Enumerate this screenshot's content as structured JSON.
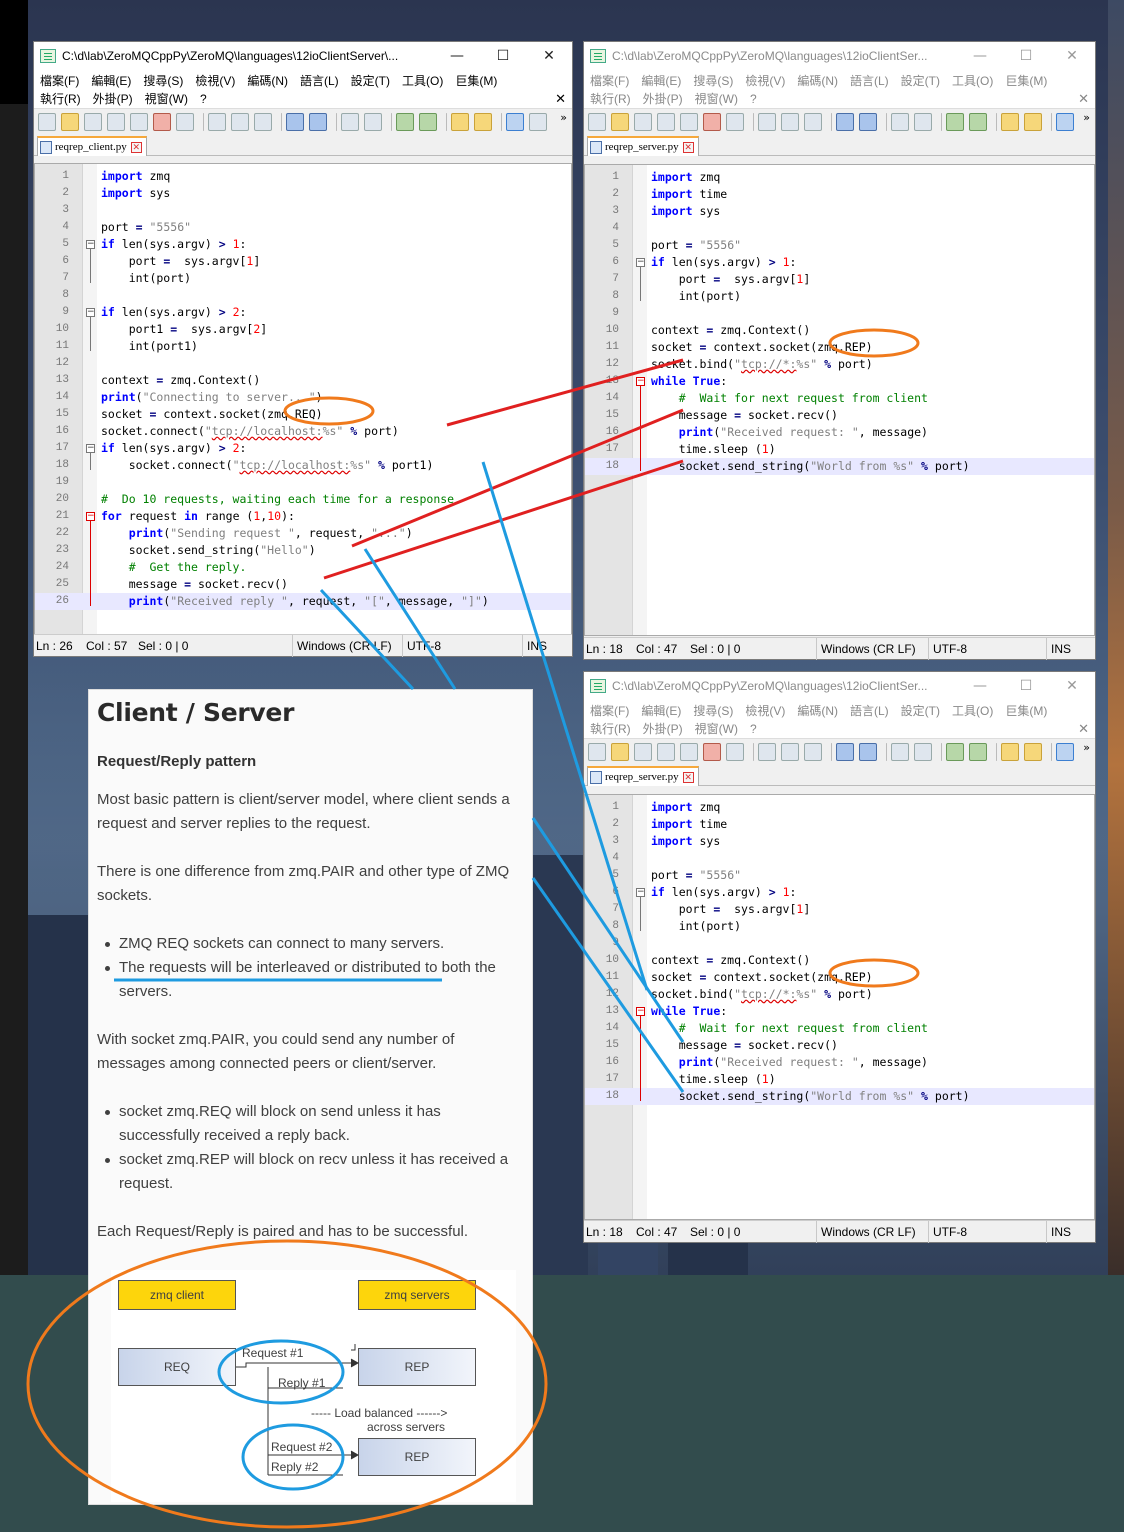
{
  "client_window": {
    "title": "C:\\d\\lab\\ZeroMQCppPy\\ZeroMQ\\languages\\12ioClientServer\\...",
    "menu_row1": [
      "檔案(F)",
      "編輯(E)",
      "搜尋(S)",
      "檢視(V)",
      "編碼(N)",
      "語言(L)",
      "設定(T)",
      "工具(O)",
      "巨集(M)"
    ],
    "menu_row2": [
      "執行(R)",
      "外掛(P)",
      "視窗(W)",
      "?"
    ],
    "tab_label": "reqrep_client.py",
    "status": {
      "ln": "Ln : 26",
      "col": "Col : 57",
      "sel": "Sel : 0 | 0",
      "eol": "Windows (CR LF)",
      "enc": "UTF-8",
      "mode": "INS"
    },
    "lines": [
      "import zmq",
      "import sys",
      "",
      "port = \"5556\"",
      "if len(sys.argv) > 1:",
      "    port =  sys.argv[1]",
      "    int(port)",
      "",
      "if len(sys.argv) > 2:",
      "    port1 =  sys.argv[2]",
      "    int(port1)",
      "",
      "context = zmq.Context()",
      "print(\"Connecting to server...\")",
      "socket = context.socket(zmq.REQ)",
      "socket.connect(\"tcp://localhost:%s\" % port)",
      "if len(sys.argv) > 2:",
      "    socket.connect(\"tcp://localhost:%s\" % port1)",
      "",
      "#  Do 10 requests, waiting each time for a response",
      "for request in range (1,10):",
      "    print(\"Sending request \", request, \"...\")",
      "    socket.send_string(\"Hello\")",
      "    #  Get the reply.",
      "    message = socket.recv()",
      "    print(\"Received reply \", request, \"[\", message, \"]\")"
    ]
  },
  "server_window_1": {
    "title": "C:\\d\\lab\\ZeroMQCppPy\\ZeroMQ\\languages\\12ioClientSer...",
    "menu_row1": [
      "檔案(F)",
      "編輯(E)",
      "搜尋(S)",
      "檢視(V)",
      "編碼(N)",
      "語言(L)",
      "設定(T)",
      "工具(O)",
      "巨集(M)"
    ],
    "menu_row2": [
      "執行(R)",
      "外掛(P)",
      "視窗(W)",
      "?"
    ],
    "tab_label": "reqrep_server.py",
    "status": {
      "ln": "Ln : 18",
      "col": "Col : 47",
      "sel": "Sel : 0 | 0",
      "eol": "Windows (CR LF)",
      "enc": "UTF-8",
      "mode": "INS"
    },
    "lines": [
      "import zmq",
      "import time",
      "import sys",
      "",
      "port = \"5556\"",
      "if len(sys.argv) > 1:",
      "    port =  sys.argv[1]",
      "    int(port)",
      "",
      "context = zmq.Context()",
      "socket = context.socket(zmq.REP)",
      "socket.bind(\"tcp://*:%s\" % port)",
      "while True:",
      "    #  Wait for next request from client",
      "    message = socket.recv()",
      "    print(\"Received request: \", message)",
      "    time.sleep (1)",
      "    socket.send_string(\"World from %s\" % port)"
    ]
  },
  "server_window_2": {
    "title": "C:\\d\\lab\\ZeroMQCppPy\\ZeroMQ\\languages\\12ioClientSer...",
    "menu_row1": [
      "檔案(F)",
      "編輯(E)",
      "搜尋(S)",
      "檢視(V)",
      "編碼(N)",
      "語言(L)",
      "設定(T)",
      "工具(O)",
      "巨集(M)"
    ],
    "menu_row2": [
      "執行(R)",
      "外掛(P)",
      "視窗(W)",
      "?"
    ],
    "tab_label": "reqrep_server.py",
    "status": {
      "ln": "Ln : 18",
      "col": "Col : 47",
      "sel": "Sel : 0 | 0",
      "eol": "Windows (CR LF)",
      "enc": "UTF-8",
      "mode": "INS"
    }
  },
  "article": {
    "title": "Client / Server",
    "subtitle": "Request/Reply pattern",
    "p1": "Most basic pattern is client/server model, where client sends a request and server replies to the request.",
    "p2": "There is one difference from zmq.PAIR and other type of ZMQ sockets.",
    "list1": [
      "ZMQ REQ sockets can connect to many servers.",
      "The requests will be interleaved or distributed to both the servers."
    ],
    "p3": "With socket zmq.PAIR, you could send any number of messages among connected peers or client/server.",
    "list2": [
      "socket zmq.REQ will block on send unless it has successfully received a reply back.",
      "socket zmq.REP will block on recv unless it has received a request."
    ],
    "p4": "Each Request/Reply is paired and has to be successful."
  },
  "diagram": {
    "client_label": "zmq client",
    "servers_label": "zmq servers",
    "req_label": "REQ",
    "rep1_label": "REP",
    "rep2_label": "REP",
    "request1": "Request #1",
    "reply1": "Reply #1",
    "request2": "Request #2",
    "reply2": "Reply #2",
    "balanced_line1": "----- Load balanced ------>",
    "balanced_line2": "across servers"
  },
  "colors": {
    "annotation_red": "#e02020",
    "annotation_blue": "#1e9be0",
    "annotation_orange": "#f07a1c"
  }
}
